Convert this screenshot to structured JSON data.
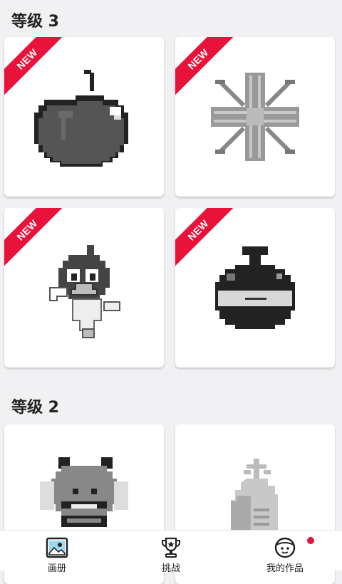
{
  "sections": [
    {
      "title": "等级 3"
    },
    {
      "title": "等级 2"
    }
  ],
  "badges": {
    "new_label": "NEW"
  },
  "nav": {
    "items": [
      {
        "label": "画册",
        "icon": "gallery-icon"
      },
      {
        "label": "挑战",
        "icon": "trophy-icon"
      },
      {
        "label": "我的作品",
        "icon": "my-works-icon"
      }
    ]
  },
  "colors": {
    "accent": "#e8123b",
    "background": "#f1f1f3"
  }
}
